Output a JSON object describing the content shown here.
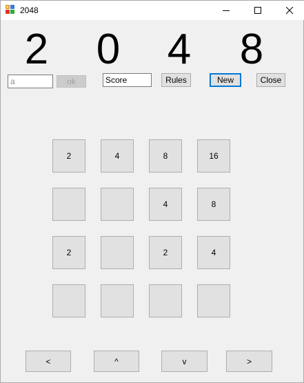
{
  "window": {
    "title": "2048"
  },
  "header": {
    "digits": [
      "2",
      "0",
      "4",
      "8"
    ]
  },
  "controls": {
    "input_value": "a",
    "ok_label": "ok",
    "score_value": "Score",
    "rules_label": "Rules",
    "new_label": "New",
    "close_label": "Close"
  },
  "board": {
    "rows": [
      [
        "2",
        "4",
        "8",
        "16"
      ],
      [
        "",
        "",
        "4",
        "8"
      ],
      [
        "2",
        "",
        "2",
        "4"
      ],
      [
        "",
        "",
        "",
        ""
      ]
    ]
  },
  "arrows": {
    "left": "<",
    "up": "^",
    "down": "v",
    "right": ">"
  },
  "colors": {
    "focus": "#0078d7",
    "background": "#f0f0f0",
    "tile": "#e1e1e1"
  }
}
